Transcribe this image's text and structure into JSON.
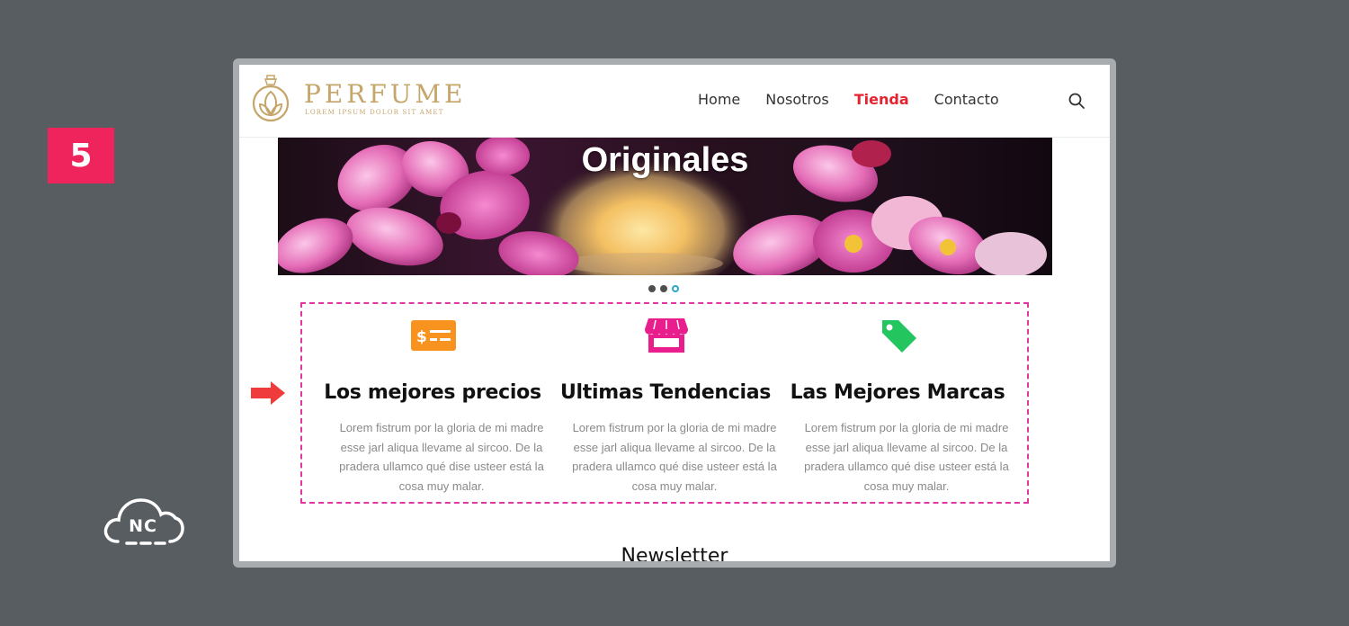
{
  "step": {
    "number": "5"
  },
  "watermark": {
    "text": "NC"
  },
  "brand": {
    "name": "PERFUME",
    "tagline": "LOREM IPSUM DOLOR SIT AMET",
    "color": "#c5a56a"
  },
  "nav": {
    "items": [
      {
        "label": "Home",
        "active": false
      },
      {
        "label": "Nosotros",
        "active": false
      },
      {
        "label": "Tienda",
        "active": true
      },
      {
        "label": "Contacto",
        "active": false
      }
    ],
    "search_icon": "search-icon"
  },
  "hero": {
    "title": "Originales",
    "slides": 3,
    "active_slide": 3
  },
  "features": [
    {
      "icon": "price-tag-card-icon",
      "icon_color": "#f7931e",
      "title": "Los mejores precios",
      "text": "Lorem fistrum por la gloria de mi madre esse jarl aliqua llevame al sircoo. De la pradera ullamco qué dise usteer está la cosa muy malar."
    },
    {
      "icon": "storefront-icon",
      "icon_color": "#e91e8c",
      "title": "Ultimas Tendencias",
      "text": "Lorem fistrum por la gloria de mi madre esse jarl aliqua llevame al sircoo. De la pradera ullamco qué dise usteer está la cosa muy malar."
    },
    {
      "icon": "tag-icon",
      "icon_color": "#22c55e",
      "title": "Las Mejores Marcas",
      "text": "Lorem fistrum por la gloria de mi madre esse jarl aliqua llevame al sircoo. De la pradera ullamco qué dise usteer está la cosa muy malar."
    }
  ],
  "newsletter": {
    "title": "Newsletter"
  },
  "colors": {
    "active_nav": "#e52431",
    "highlight_border": "#e0369f",
    "step_badge": "#f0245d",
    "arrow": "#ef3b3b"
  }
}
